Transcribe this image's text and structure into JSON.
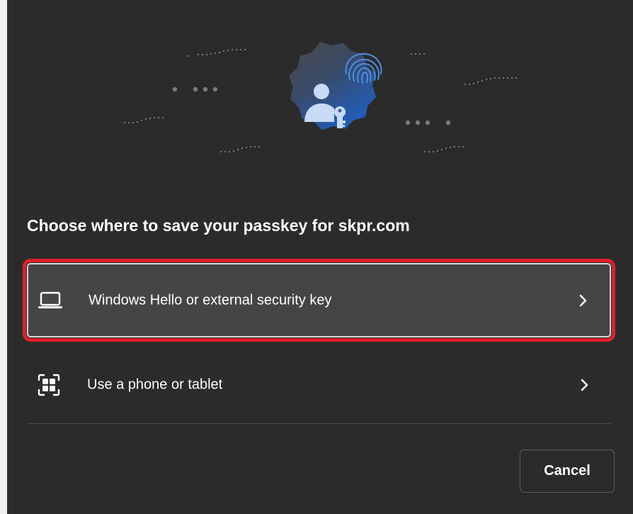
{
  "dialog": {
    "title": "Choose where to save your passkey for skpr.com",
    "options": [
      {
        "label": "Windows Hello or external security key",
        "icon": "laptop-icon",
        "selected": true
      },
      {
        "label": "Use a phone or tablet",
        "icon": "qr-code-icon",
        "selected": false
      }
    ],
    "cancel_label": "Cancel"
  },
  "colors": {
    "background": "#2b2b2b",
    "selected_option": "#454545",
    "highlight_border": "#e0202a",
    "badge_gradient_start": "#4a4a4a",
    "badge_gradient_end": "#1f5fc0",
    "accent_blue": "#4c8fe6"
  }
}
